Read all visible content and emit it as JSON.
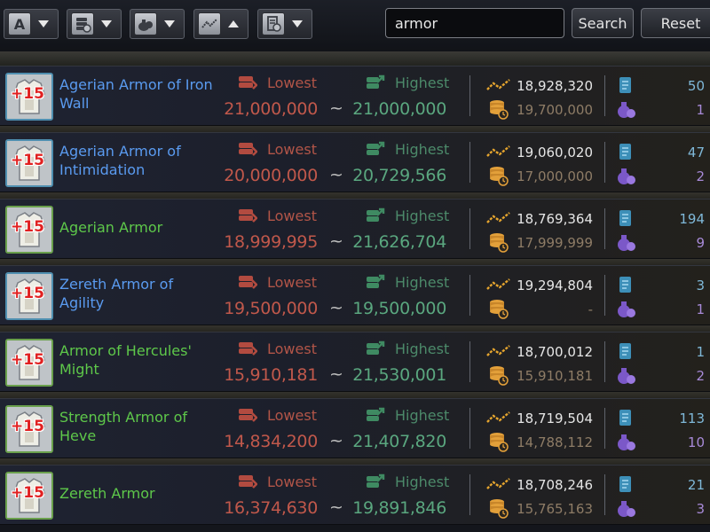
{
  "search": {
    "value": "armor",
    "search_label": "Search",
    "reset_label": "Reset"
  },
  "sort_buttons": [
    {
      "icon": "alphabet-icon",
      "glyph": "A",
      "direction": "down"
    },
    {
      "icon": "price-stack-icon",
      "direction": "down"
    },
    {
      "icon": "money-bag-icon",
      "direction": "down"
    },
    {
      "icon": "trend-icon",
      "direction": "up"
    },
    {
      "icon": "receipt-icon",
      "direction": "down"
    }
  ],
  "labels": {
    "lowest": "Lowest",
    "highest": "Highest",
    "tilde": "~"
  },
  "colors": {
    "name_blue": "#5a9bf0",
    "name_green": "#5ec84a",
    "lowest": "#c0584b",
    "highest": "#5aa77f"
  },
  "items": [
    {
      "name": "Agerian Armor of Iron Wall",
      "enhancement": "+15",
      "grade": "blue",
      "lowest": "21,000,000",
      "highest": "21,000,000",
      "avg_price": "18,928,320",
      "last_price": "19,700,000",
      "listed": "50",
      "registered": "1"
    },
    {
      "name": "Agerian Armor of Intimidation",
      "enhancement": "+15",
      "grade": "blue",
      "lowest": "20,000,000",
      "highest": "20,729,566",
      "avg_price": "19,060,020",
      "last_price": "17,000,000",
      "listed": "47",
      "registered": "2"
    },
    {
      "name": "Agerian Armor",
      "enhancement": "+15",
      "grade": "green",
      "lowest": "18,999,995",
      "highest": "21,626,704",
      "avg_price": "18,769,364",
      "last_price": "17,999,999",
      "listed": "194",
      "registered": "9"
    },
    {
      "name": "Zereth Armor of Agility",
      "enhancement": "+15",
      "grade": "blue",
      "lowest": "19,500,000",
      "highest": "19,500,000",
      "avg_price": "19,294,804",
      "last_price": "-",
      "listed": "3",
      "registered": "1"
    },
    {
      "name": "Armor of Hercules' Might",
      "enhancement": "+15",
      "grade": "green",
      "lowest": "15,910,181",
      "highest": "21,530,001",
      "avg_price": "18,700,012",
      "last_price": "15,910,181",
      "listed": "1",
      "registered": "2"
    },
    {
      "name": "Strength Armor of Heve",
      "enhancement": "+15",
      "grade": "green",
      "lowest": "14,834,200",
      "highest": "21,407,820",
      "avg_price": "18,719,504",
      "last_price": "14,788,112",
      "listed": "113",
      "registered": "10"
    },
    {
      "name": "Zereth Armor",
      "enhancement": "+15",
      "grade": "green",
      "lowest": "16,374,630",
      "highest": "19,891,846",
      "avg_price": "18,708,246",
      "last_price": "15,765,163",
      "listed": "21",
      "registered": "3"
    }
  ]
}
